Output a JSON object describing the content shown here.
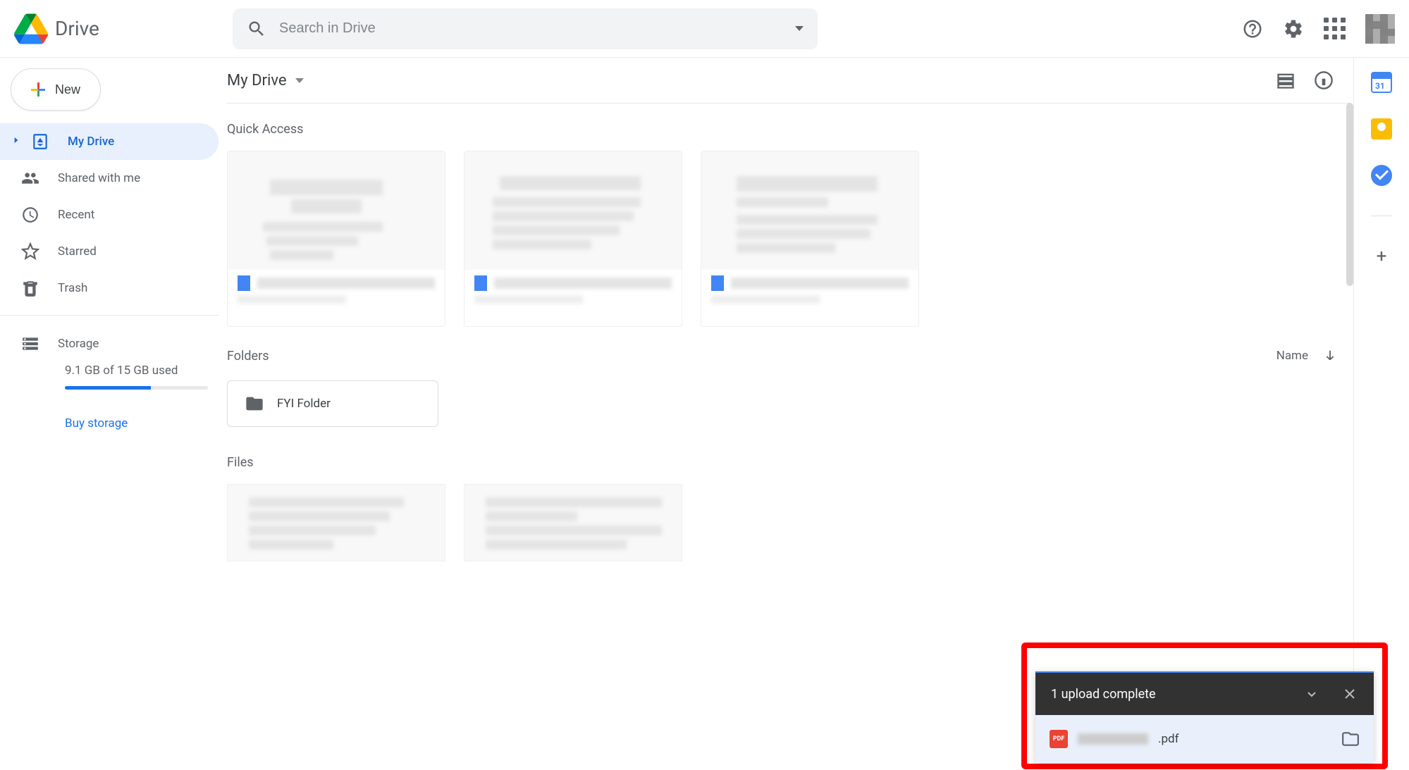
{
  "app": {
    "name": "Drive"
  },
  "search": {
    "placeholder": "Search in Drive"
  },
  "newButton": {
    "label": "New"
  },
  "nav": {
    "myDrive": "My Drive",
    "sharedWithMe": "Shared with me",
    "recent": "Recent",
    "starred": "Starred",
    "trash": "Trash"
  },
  "storage": {
    "label": "Storage",
    "usedText": "9.1 GB of 15 GB used",
    "percent": 60,
    "buy": "Buy storage"
  },
  "main": {
    "breadcrumb": "My Drive",
    "quickAccess": "Quick Access",
    "foldersLabel": "Folders",
    "sortLabel": "Name",
    "folder1": "FYI Folder",
    "filesLabel": "Files"
  },
  "uploadToast": {
    "title": "1 upload complete",
    "pdfBadge": "PDF",
    "ext": ".pdf"
  },
  "sidepanel": {
    "calendarDay": "31"
  }
}
